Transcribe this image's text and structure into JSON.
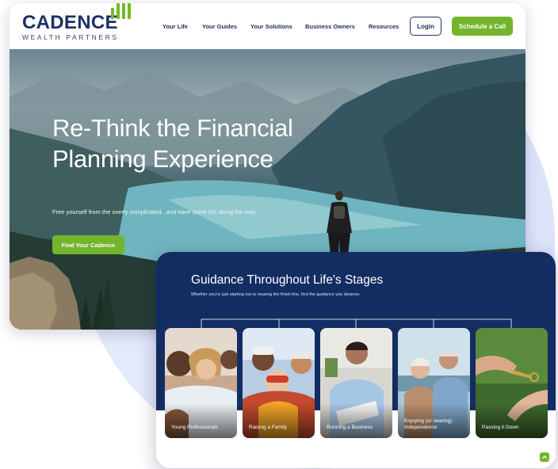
{
  "brand": {
    "name": "CADENCE",
    "tagline": "WEALTH PARTNERS",
    "accent_color": "#73b52c",
    "navy_color": "#132d63"
  },
  "nav": {
    "links": [
      "Your Life",
      "Your Guides",
      "Your Solutions",
      "Business Owners",
      "Resources"
    ],
    "login_label": "Login",
    "cta_label": "Schedule a Call"
  },
  "hero": {
    "title": "Re-Think the Financial Planning Experience",
    "subtitle": "Free yourself from the overly complicated...and have some fun along the way.",
    "button_label": "Find Your Cadence"
  },
  "stages": {
    "title": "Guidance Throughout Life's Stages",
    "subtitle": "Whether you're just starting out or nearing the finish line, find the guidance you deserve.",
    "cards": [
      {
        "label": "Young Professionals"
      },
      {
        "label": "Raising a Family"
      },
      {
        "label": "Running a Business"
      },
      {
        "label": "Enjoying (or nearing) Independence"
      },
      {
        "label": "Passing it Down"
      }
    ]
  },
  "icons": {
    "scroll_top": "chevron-up-icon"
  }
}
